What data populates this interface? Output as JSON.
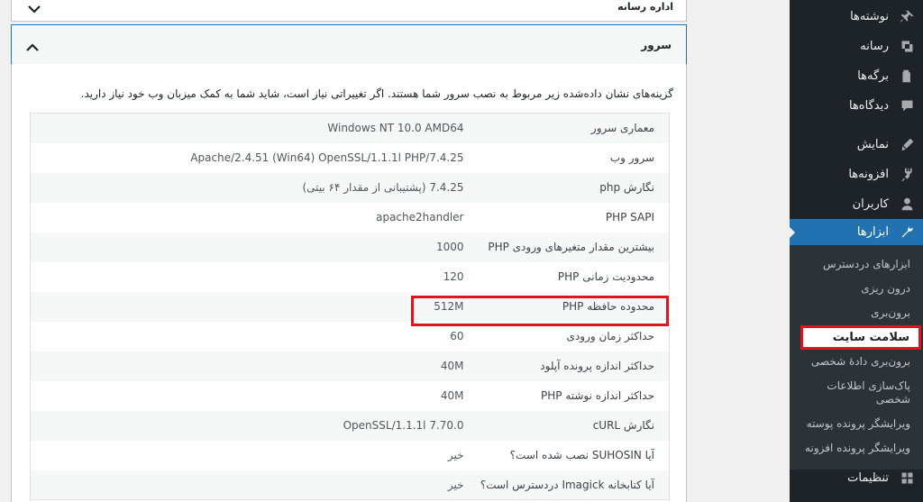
{
  "sidebar": {
    "items": [
      {
        "label": "نوشته‌ها",
        "icon": "pin-icon"
      },
      {
        "label": "رسانه",
        "icon": "media-icon"
      },
      {
        "label": "برگه‌ها",
        "icon": "pages-icon"
      },
      {
        "label": "دیدگاه‌ها",
        "icon": "comments-icon"
      },
      {
        "label": "نمایش",
        "icon": "appearance-icon"
      },
      {
        "label": "افزونه‌ها",
        "icon": "plugins-icon"
      },
      {
        "label": "کاربران",
        "icon": "users-icon"
      },
      {
        "label": "ابزارها",
        "icon": "tools-icon"
      }
    ],
    "submenu": [
      "ابزارهای دردسترس",
      "درون ریزی",
      "برون‌بری",
      "سلامت سایت",
      "برون‌بری دادهٔ شخصی",
      "پاک‌سازی اطلاعات شخصی",
      "ویرایشگر پرونده پوسته",
      "ویرایشگر پرونده افزونه"
    ],
    "settings": "تنظیمات"
  },
  "accordion": {
    "media_title": "اداره رسانه",
    "server_title": "سرور"
  },
  "server": {
    "description": "گزینه‌های نشان داده‌شده زیر مربوط به نصب سرور شما هستند. اگر تغییراتی نیاز است، شاید شما به کمک میزبان وب خود نیاز دارید.",
    "rows": [
      {
        "label": "معماری سرور",
        "value": "Windows NT 10.0 AMD64"
      },
      {
        "label": "سرور وب",
        "value": "Apache/2.4.51 (Win64) OpenSSL/1.1.1l PHP/7.4.25"
      },
      {
        "label": "نگارش php",
        "value": "7.4.25 (پشتیبانی از مقدار ۶۴ بیتی)"
      },
      {
        "label": "PHP SAPI",
        "value": "apache2handler"
      },
      {
        "label": "بیشترین مقدار متغیرهای ورودی PHP",
        "value": "1000"
      },
      {
        "label": "محدودیت زمانی PHP",
        "value": "120"
      },
      {
        "label": "محدوده حافظه PHP",
        "value": "512M"
      },
      {
        "label": "حداکثر زمان ورودی",
        "value": "60"
      },
      {
        "label": "حداکثر اندازه پرونده آپلود",
        "value": "40M"
      },
      {
        "label": "حداکثر اندازه نوشته PHP",
        "value": "40M"
      },
      {
        "label": "نگارش cURL",
        "value": "7.70.0 OpenSSL/1.1.1l"
      },
      {
        "label": "آیا SUHOSIN نصب شده است؟",
        "value": "خیر"
      },
      {
        "label": "آیا کتابخانه Imagick دردسترس است؟",
        "value": "خیر"
      }
    ]
  },
  "colors": {
    "sidebar_bg": "#1d2327",
    "accent": "#2271b1",
    "highlight": "#e0141e"
  }
}
